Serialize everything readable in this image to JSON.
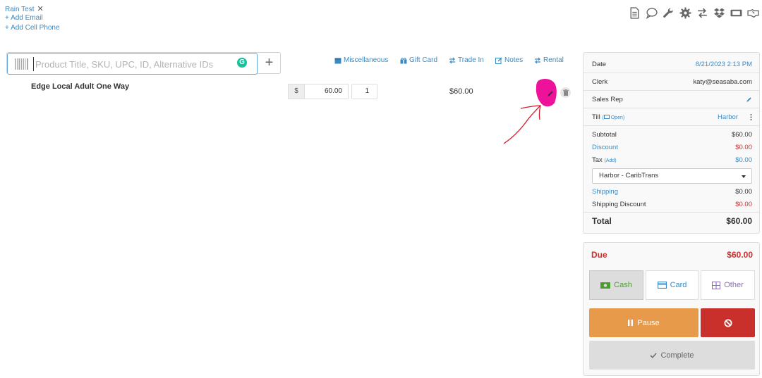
{
  "customer": {
    "name": "Rain Test",
    "remove_symbol": "✕",
    "add_email": "+ Add Email",
    "add_phone": "+ Add Cell Phone"
  },
  "toolbar": {
    "icons": [
      "document-icon",
      "comment-icon",
      "wrench-icon",
      "gear-icon",
      "exchange-icon",
      "dropbox-icon",
      "ticket-icon",
      "handshake-icon"
    ]
  },
  "search": {
    "placeholder": "Product Title, SKU, UPC, ID, Alternative IDs",
    "value": "",
    "add_symbol": "+"
  },
  "actions": {
    "miscellaneous": "Miscellaneous",
    "gift_card": "Gift Card",
    "trade_in": "Trade In",
    "notes": "Notes",
    "rental": "Rental"
  },
  "line_item": {
    "title": "Edge Local Adult One Way",
    "currency_symbol": "$",
    "price": "60.00",
    "quantity": "1",
    "total": "$60.00"
  },
  "summary": {
    "date_label": "Date",
    "date_value": "8/21/2023 2:13 PM",
    "clerk_label": "Clerk",
    "clerk_value": "katy@seasaba.com",
    "sales_rep_label": "Sales Rep",
    "till_label": "Till",
    "till_open": "Open",
    "till_value": "Harbor",
    "subtotal_label": "Subtotal",
    "subtotal_value": "$60.00",
    "discount_label": "Discount",
    "discount_value": "$0.00",
    "tax_label": "Tax",
    "tax_add": "(Add)",
    "tax_value": "$0.00",
    "tax_select": "Harbor - CaribTrans",
    "shipping_label": "Shipping",
    "shipping_value": "$0.00",
    "shipping_discount_label": "Shipping Discount",
    "shipping_discount_value": "$0.00",
    "total_label": "Total",
    "total_value": "$60.00"
  },
  "payment": {
    "due_label": "Due",
    "due_value": "$60.00",
    "cash": "Cash",
    "card": "Card",
    "other": "Other",
    "pause": "Pause",
    "complete": "Complete"
  },
  "colors": {
    "link": "#3a8ac4",
    "danger": "#c9302c",
    "pause": "#e89a4b",
    "cash": "#4a9d2f",
    "annotation": "#ee1199"
  }
}
